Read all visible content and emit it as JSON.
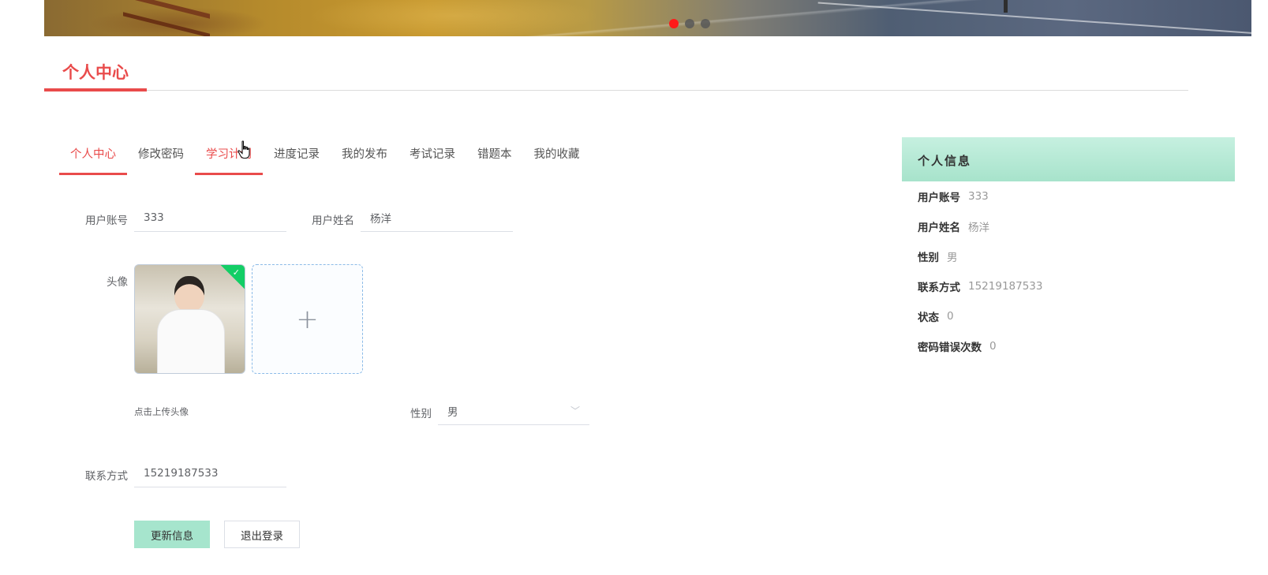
{
  "banner": {
    "dots": [
      {
        "active": true
      },
      {
        "active": false
      },
      {
        "active": false
      }
    ]
  },
  "section": {
    "title": "个人中心"
  },
  "tabs": [
    {
      "label": "个人中心"
    },
    {
      "label": "修改密码"
    },
    {
      "label": "学习计划"
    },
    {
      "label": "进度记录"
    },
    {
      "label": "我的发布"
    },
    {
      "label": "考试记录"
    },
    {
      "label": "错题本"
    },
    {
      "label": "我的收藏"
    }
  ],
  "form": {
    "account_label": "用户账号",
    "account_value": "333",
    "name_label": "用户姓名",
    "name_value": "杨洋",
    "avatar_label": "头像",
    "upload_tip": "点击上传头像",
    "gender_label": "性别",
    "gender_value": "男",
    "phone_label": "联系方式",
    "phone_value": "15219187533",
    "update_button": "更新信息",
    "logout_button": "退出登录"
  },
  "side": {
    "title": "个人信息",
    "rows": [
      {
        "key": "用户账号",
        "value": "333"
      },
      {
        "key": "用户姓名",
        "value": "杨洋"
      },
      {
        "key": "性别",
        "value": "男"
      },
      {
        "key": "联系方式",
        "value": "15219187533"
      },
      {
        "key": "状态",
        "value": "0"
      },
      {
        "key": "密码错误次数",
        "value": "0"
      }
    ]
  },
  "colors": {
    "accent": "#e94b4b",
    "primary_button": "#a6e5cd",
    "side_header": "#b4e8d3",
    "upload_success": "#13ce66"
  },
  "icons": {
    "upload": "plus-icon",
    "select": "chevron-down-icon",
    "success": "check-icon",
    "cursor": "hand-pointer-icon"
  }
}
